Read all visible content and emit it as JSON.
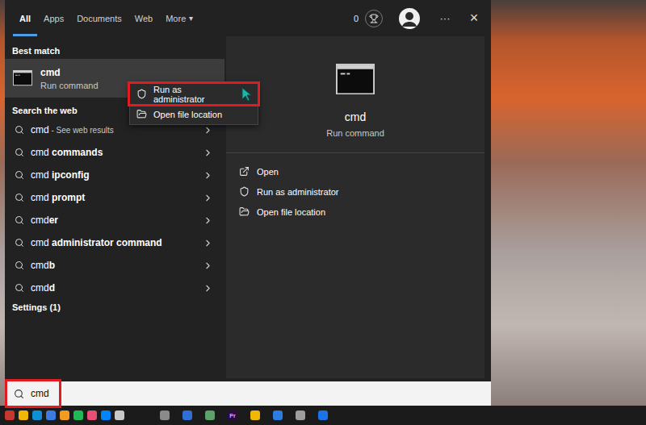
{
  "start_search": {
    "tabs": [
      {
        "label": "All",
        "selected": true,
        "caret": ""
      },
      {
        "label": "Apps",
        "selected": false,
        "caret": ""
      },
      {
        "label": "Documents",
        "selected": false,
        "caret": ""
      },
      {
        "label": "Web",
        "selected": false,
        "caret": ""
      },
      {
        "label": "More",
        "selected": false,
        "caret": "▾"
      }
    ],
    "points": "0",
    "more": "···",
    "close": "×"
  },
  "best_match": {
    "header": "Best match",
    "title": "cmd",
    "subtitle": "Run command",
    "selected": true
  },
  "context_menu": [
    {
      "label": "Run as administrator",
      "highlighted": true,
      "kind": "admin"
    },
    {
      "label": "Open file location",
      "highlighted": false,
      "kind": "location"
    }
  ],
  "web": {
    "header": "Search the web",
    "items": [
      {
        "typed": "cmd",
        "completion": "",
        "note": " - See web results"
      },
      {
        "typed": "cmd",
        "completion": " commands",
        "note": ""
      },
      {
        "typed": "cmd",
        "completion": " ipconfig",
        "note": ""
      },
      {
        "typed": "cmd",
        "completion": " prompt",
        "note": ""
      },
      {
        "typed": "cmd",
        "completion": "er",
        "note": ""
      },
      {
        "typed": "cmd",
        "completion": " administrator command",
        "note": ""
      },
      {
        "typed": "cmd",
        "completion": "b",
        "note": ""
      },
      {
        "typed": "cmd",
        "completion": "d",
        "note": ""
      }
    ]
  },
  "settings": {
    "header": "Settings (1)"
  },
  "preview": {
    "title": "cmd",
    "subtitle": "Run command",
    "actions": [
      {
        "label": "Open",
        "kind": "open"
      },
      {
        "label": "Run as administrator",
        "kind": "admin"
      },
      {
        "label": "Open file location",
        "kind": "location"
      }
    ]
  },
  "search_box": {
    "value": "cmd",
    "highlighted": true
  },
  "taskbar": {
    "left": [
      {
        "color": "#c7362f",
        "label": ""
      },
      {
        "color": "#f2b705",
        "label": ""
      },
      {
        "color": "#0f8fd6",
        "label": ""
      },
      {
        "color": "#3c7be0",
        "label": ""
      },
      {
        "color": "#f29c1f",
        "label": ""
      },
      {
        "color": "#1db954",
        "label": ""
      },
      {
        "color": "#e94e77",
        "label": ""
      },
      {
        "color": "#0084ff",
        "label": ""
      },
      {
        "color": "#c8c8c8",
        "label": ""
      }
    ],
    "right": [
      {
        "color": "#8a8a8a",
        "label": ""
      },
      {
        "color": "#2f6fd6",
        "label": ""
      },
      {
        "color": "#5aa469",
        "label": ""
      },
      {
        "color": "#2a0a4a",
        "label": "Pr"
      },
      {
        "color": "#f2b705",
        "label": ""
      },
      {
        "color": "#2a7de1",
        "label": ""
      },
      {
        "color": "#9e9e9e",
        "label": ""
      },
      {
        "color": "#1a73e8",
        "label": ""
      }
    ]
  }
}
